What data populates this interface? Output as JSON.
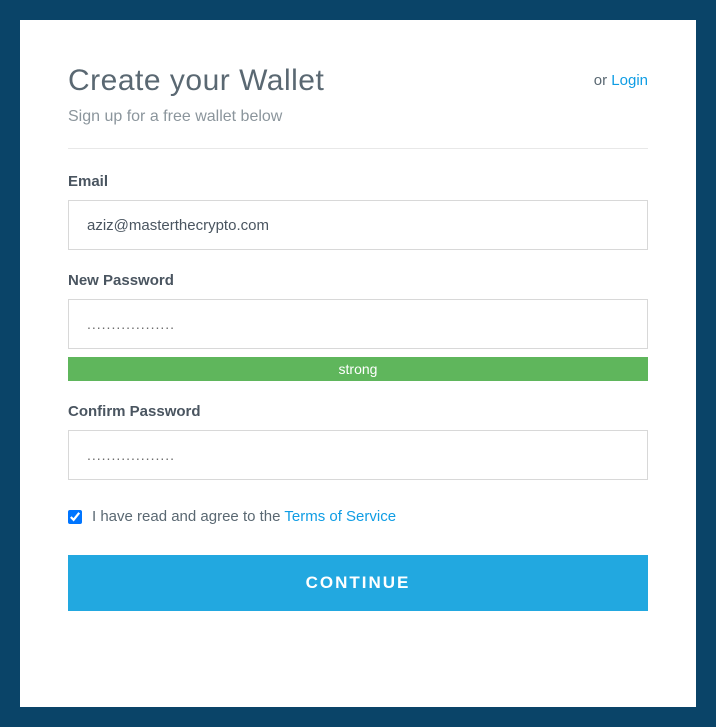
{
  "header": {
    "title": "Create your Wallet",
    "login_prefix": "or ",
    "login_link": "Login",
    "subtitle": "Sign up for a free wallet below"
  },
  "form": {
    "email": {
      "label": "Email",
      "value": "aziz@masterthecrypto.com"
    },
    "new_password": {
      "label": "New Password",
      "value": "..................",
      "strength_label": "strong"
    },
    "confirm_password": {
      "label": "Confirm Password",
      "value": ".................."
    },
    "tos": {
      "checked": true,
      "text_prefix": "I have read and agree to the ",
      "link_text": "Terms of Service"
    },
    "submit_label": "CONTINUE"
  }
}
